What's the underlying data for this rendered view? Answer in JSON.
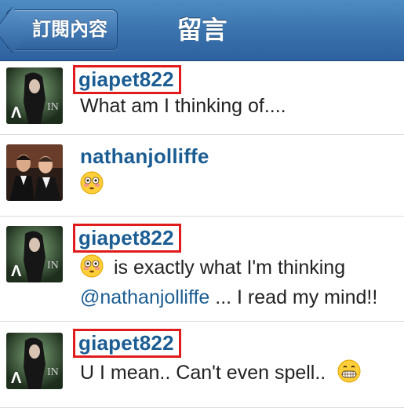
{
  "nav": {
    "back_label": "訂閱內容",
    "title": "留言"
  },
  "comments": [
    {
      "username": "giapet822",
      "text": "What am I thinking of....",
      "highlighted": true
    },
    {
      "username": "nathanjolliffe",
      "emoji": "flushed-face",
      "highlighted": false
    },
    {
      "username": "giapet822",
      "emoji": "flushed-face",
      "text_line1": "is exactly what I'm thinking",
      "mention": "@nathanjolliffe",
      "text_line2_rest": " ... I read my mind!!",
      "highlighted": true
    },
    {
      "username": "giapet822",
      "text": "U I mean.. Can't even spell..",
      "emoji": "grimacing-face",
      "highlighted": true
    }
  ],
  "colors": {
    "nav_bar": "#3a73ad",
    "username": "#1b5d93",
    "highlight_box": "#e01b1b"
  }
}
